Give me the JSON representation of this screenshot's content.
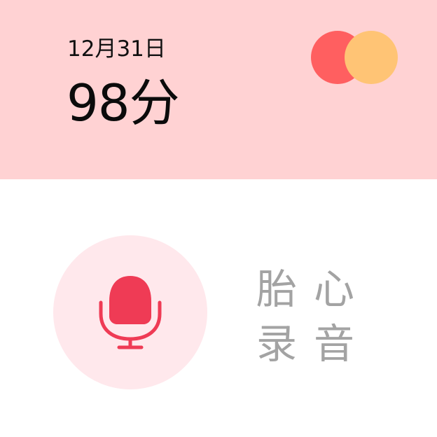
{
  "header": {
    "date": "12月31日",
    "score": "98分",
    "background": "#ffd2d3"
  },
  "logo": {
    "name": "mastercard-logo-icon",
    "colors": [
      "#ff5f60",
      "#ffc475"
    ]
  },
  "record_button": {
    "icon": "microphone-icon",
    "circle_color": "#ffe8ec",
    "icon_color": "#ef3b55"
  },
  "label": {
    "chars": [
      "胎",
      "心",
      "录",
      "音"
    ],
    "color": "#a3a3a3"
  }
}
